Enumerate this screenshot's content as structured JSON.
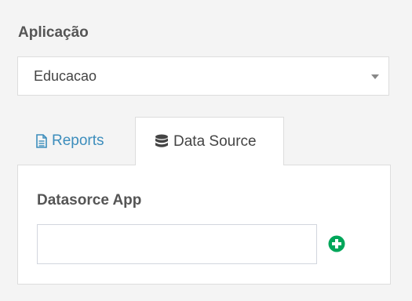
{
  "application": {
    "label": "Aplicação",
    "selected_value": "Educacao"
  },
  "tabs": [
    {
      "label": "Reports",
      "icon": "file-text-icon",
      "active": false
    },
    {
      "label": "Data Source",
      "icon": "database-icon",
      "active": true
    }
  ],
  "datasource": {
    "label": "Datasorce App",
    "input_value": "",
    "add_icon": "plus-circle-icon"
  },
  "colors": {
    "link": "#3c8dbc",
    "add_button": "#00a65a"
  }
}
